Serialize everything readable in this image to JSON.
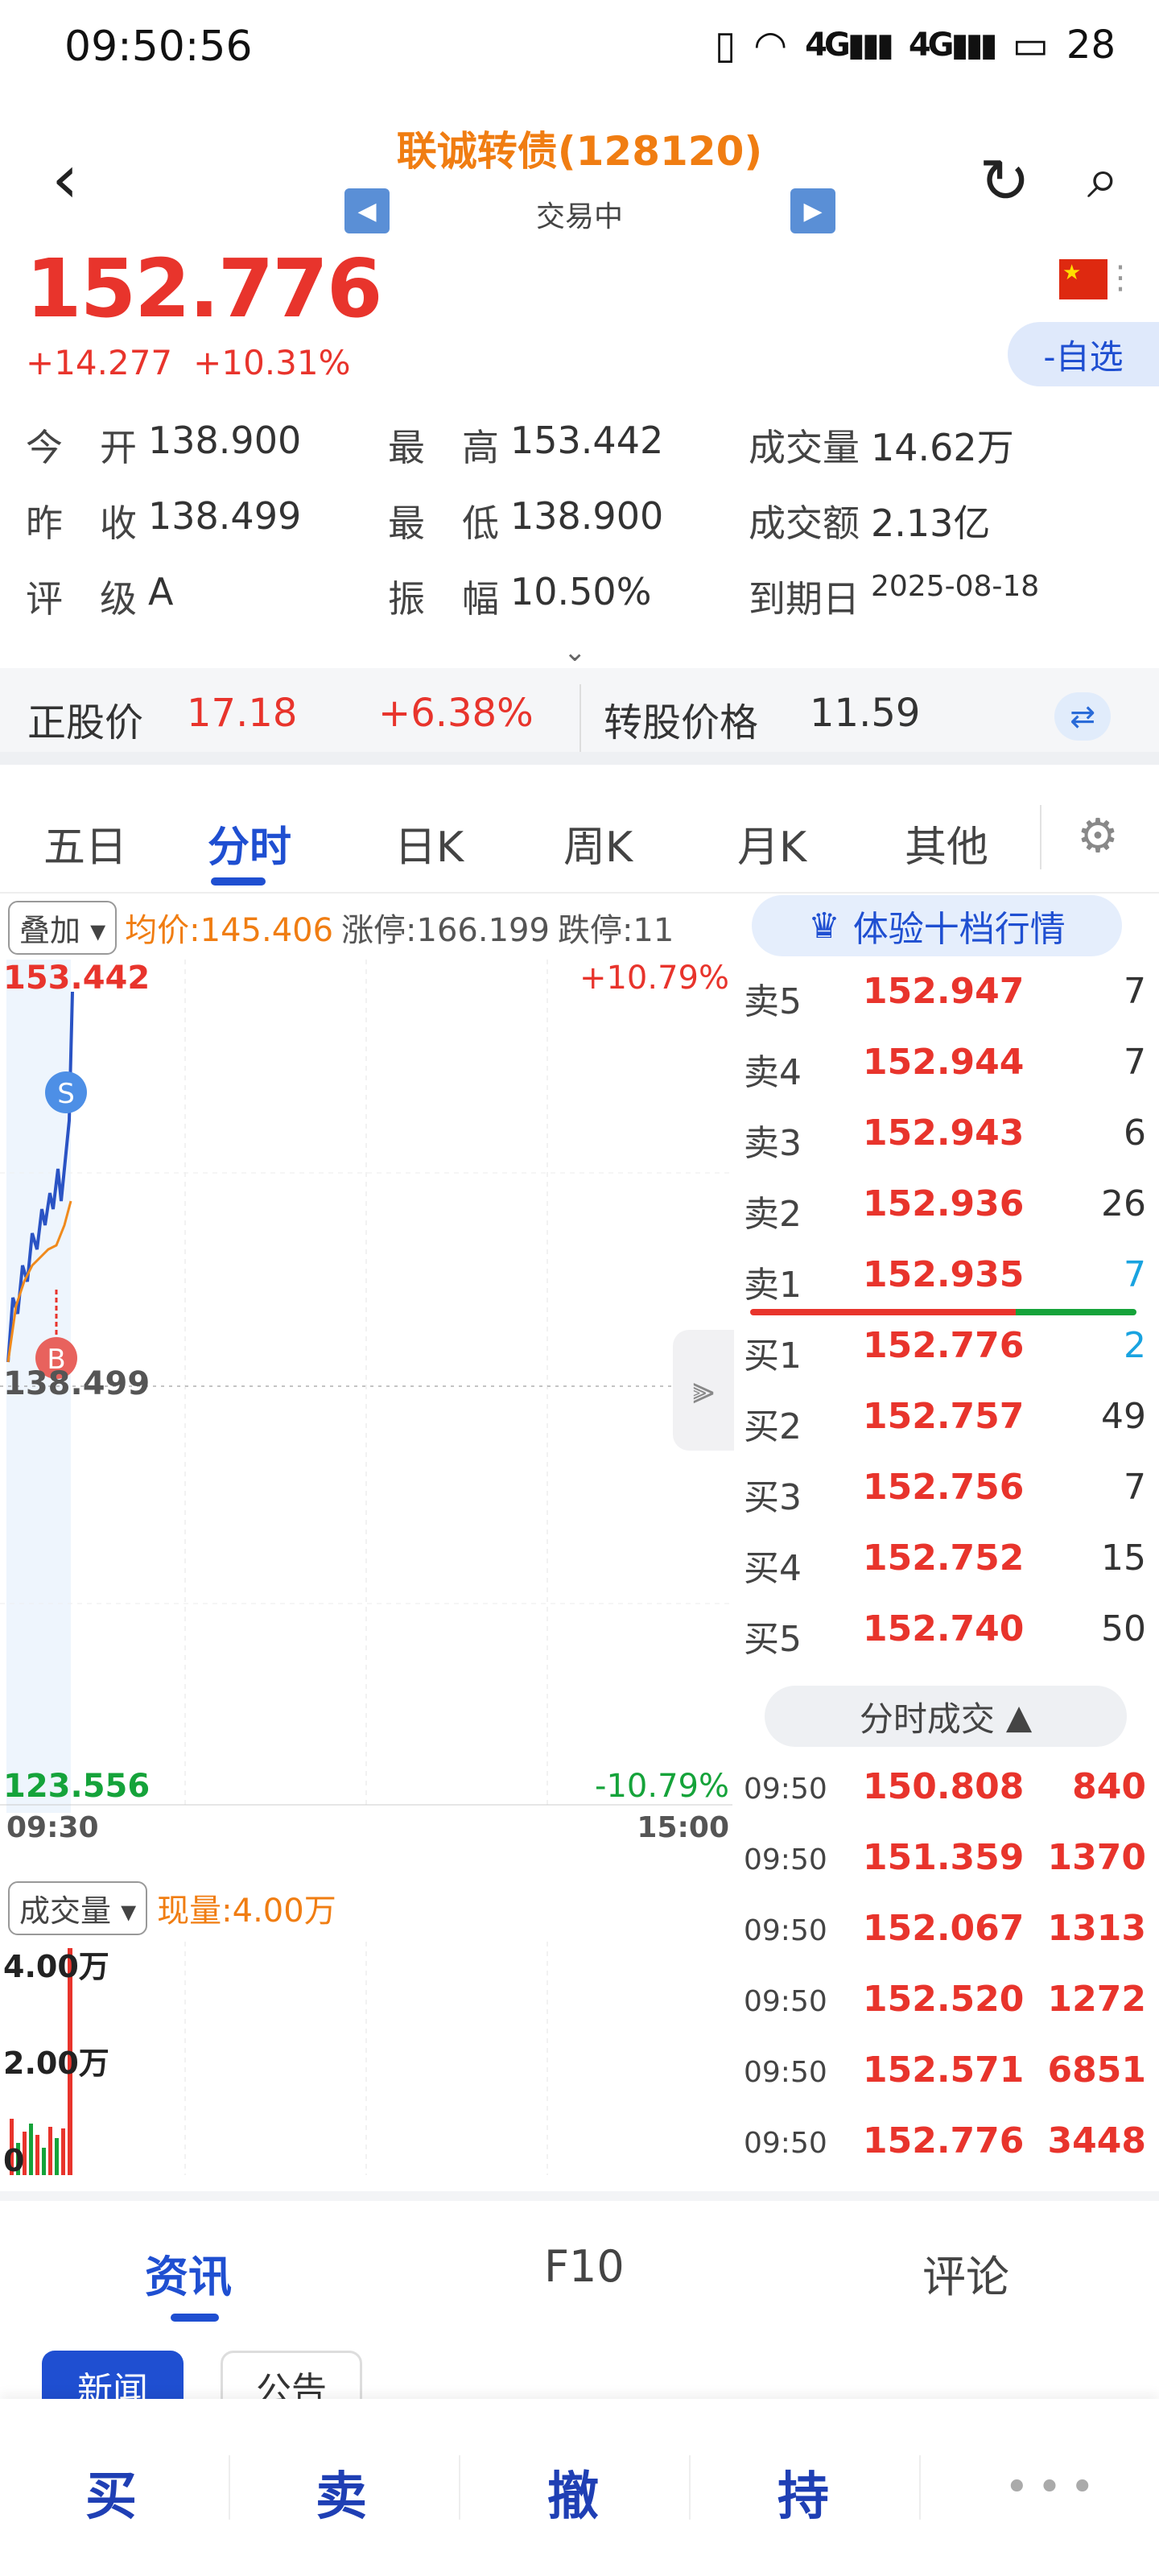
{
  "status": {
    "time": "09:50:56",
    "battery": "28",
    "net1": "4G",
    "net2": "4G"
  },
  "header": {
    "title": "联诚转债(128120)",
    "state": "交易中"
  },
  "quote": {
    "price": "152.776",
    "change": "+14.277",
    "change_pct": "+10.31%",
    "fav_label": "-自选"
  },
  "stats": [
    [
      {
        "k": "今　开",
        "v": "138.900"
      },
      {
        "k": "最　高",
        "v": "153.442"
      },
      {
        "k": "成交量",
        "v": "14.62万"
      }
    ],
    [
      {
        "k": "昨　收",
        "v": "138.499"
      },
      {
        "k": "最　低",
        "v": "138.900"
      },
      {
        "k": "成交额",
        "v": "2.13亿"
      }
    ],
    [
      {
        "k": "评　级",
        "v": "A"
      },
      {
        "k": "振　幅",
        "v": "10.50%"
      },
      {
        "k": "到期日",
        "v": "2025-08-18"
      }
    ]
  ],
  "stock": {
    "label": "正股价",
    "price": "17.18",
    "pct": "+6.38%",
    "conv_label": "转股价格",
    "conv_price": "11.59"
  },
  "tabs": [
    "五日",
    "分时",
    "日K",
    "周K",
    "月K",
    "其他"
  ],
  "chart_bar": {
    "overlay": "叠加",
    "avg": "均价:145.406",
    "limit_up": "涨停:166.199",
    "limit_down": "跌停:11"
  },
  "chart_labels": {
    "high": "153.442",
    "high_pct": "+10.79%",
    "mid": "138.499",
    "low": "123.556",
    "low_pct": "-10.79%",
    "t_start": "09:30",
    "t_end": "15:00",
    "sell_marker": "S",
    "buy_marker": "B"
  },
  "volume": {
    "selector": "成交量",
    "current": "现量:4.00万",
    "y_top": "4.00万",
    "y_mid": "2.00万",
    "y_zero": "0"
  },
  "book": {
    "vip": "体验十档行情",
    "asks": [
      {
        "n": "卖5",
        "p": "152.947",
        "q": "7"
      },
      {
        "n": "卖4",
        "p": "152.944",
        "q": "7"
      },
      {
        "n": "卖3",
        "p": "152.943",
        "q": "6"
      },
      {
        "n": "卖2",
        "p": "152.936",
        "q": "26"
      },
      {
        "n": "卖1",
        "p": "152.935",
        "q": "7"
      }
    ],
    "bids": [
      {
        "n": "买1",
        "p": "152.776",
        "q": "2"
      },
      {
        "n": "买2",
        "p": "152.757",
        "q": "49"
      },
      {
        "n": "买3",
        "p": "152.756",
        "q": "7"
      },
      {
        "n": "买4",
        "p": "152.752",
        "q": "15"
      },
      {
        "n": "买5",
        "p": "152.740",
        "q": "50"
      }
    ],
    "trades_label": "分时成交",
    "trades": [
      {
        "t": "09:50",
        "p": "150.808",
        "v": "840"
      },
      {
        "t": "09:50",
        "p": "151.359",
        "v": "1370"
      },
      {
        "t": "09:50",
        "p": "152.067",
        "v": "1313"
      },
      {
        "t": "09:50",
        "p": "152.520",
        "v": "1272"
      },
      {
        "t": "09:50",
        "p": "152.571",
        "v": "6851"
      },
      {
        "t": "09:50",
        "p": "152.776",
        "v": "3448"
      }
    ]
  },
  "info_tabs": [
    "资讯",
    "F10",
    "评论"
  ],
  "sub_tabs": [
    "新闻",
    "公告"
  ],
  "trade": [
    "买",
    "卖",
    "撤",
    "持"
  ],
  "colors": {
    "up": "#e8342c",
    "down": "#15a33a",
    "accent": "#1f4fd1",
    "orange": "#f07d12"
  }
}
